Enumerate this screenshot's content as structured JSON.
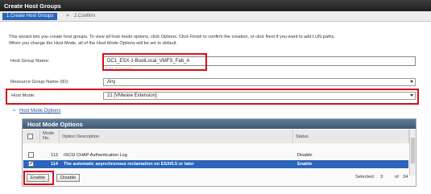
{
  "window": {
    "title": "Create Host Groups"
  },
  "steps": {
    "active": "1.Create Host Groups",
    "separator": ">",
    "next": "2.Confirm"
  },
  "intro": {
    "line1": "This wizard lets you create host groups. To view all host mode options, click Options. Click Finish to confirm the creation, or click Next if you want to add LUN paths.",
    "line2": "When you change the Host Mode, all of the Host Mode Options will be set to default."
  },
  "form": {
    "host_group_name_label": "Host Group Name:",
    "host_group_name_value": "DC1_ESX-1-BootLocal_VMFS_Fab_A",
    "host_group_name_hint": "(1-64 characters)",
    "resource_group_label": "Resource Group Name (ID):",
    "resource_group_value": "Any",
    "host_mode_label": "Host Mode:",
    "host_mode_value": "21 [VMware Extension]"
  },
  "options_panel": {
    "toggle_icon": "≈",
    "toggle_label": "Host Mode Options",
    "title": "Host Mode Options",
    "columns": {
      "mode_no": "Mode\nNo.",
      "description": "Option Description",
      "status": "Status"
    },
    "rows": [
      {
        "mode": "113",
        "description": "iSCSI CHAP Authentication Log",
        "status": "Disable",
        "checked": false,
        "selected": false
      },
      {
        "mode": "114",
        "description": "The automatic asynchronous reclamation on ESXi6.5 or later",
        "status": "Enable",
        "checked": true,
        "selected": true
      }
    ],
    "enable_button": "Enable",
    "disable_button": "Disable",
    "selected_label": "Selected:",
    "selected_count": "3",
    "of_label": "of",
    "total_count": "34"
  },
  "colors": {
    "accent": "#2b64bb",
    "highlight": "#d10f1b",
    "panel_header": "#4a6580"
  }
}
